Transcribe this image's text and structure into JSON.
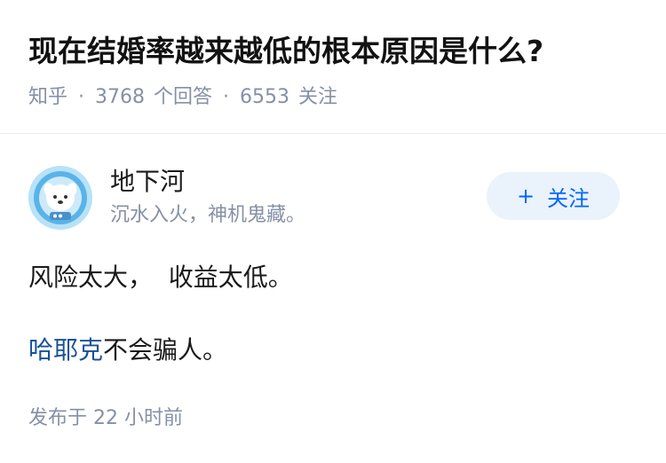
{
  "question": {
    "title": "现在结婚率越来越低的根本原因是什么?",
    "source": "知乎",
    "separator": "·",
    "answer_count": "3768",
    "answer_label": "个回答",
    "follower_count": "6553",
    "follower_label": "关注"
  },
  "answer": {
    "author": {
      "name": "地下河",
      "bio": "沉水入火，神机鬼藏。"
    },
    "follow_button": {
      "icon": "+",
      "label": "关注"
    },
    "line1": "风险太大，  收益太低。",
    "line2_link": "哈耶克",
    "line2_rest": "不会骗人。",
    "published": "发布于  22 小时前"
  },
  "colors": {
    "meta_gray": "#8590a6",
    "link_blue": "#175199",
    "follow_blue": "#0066ff",
    "follow_bg": "#eaf3fb",
    "avatar_bg": "#b7e2f7"
  }
}
